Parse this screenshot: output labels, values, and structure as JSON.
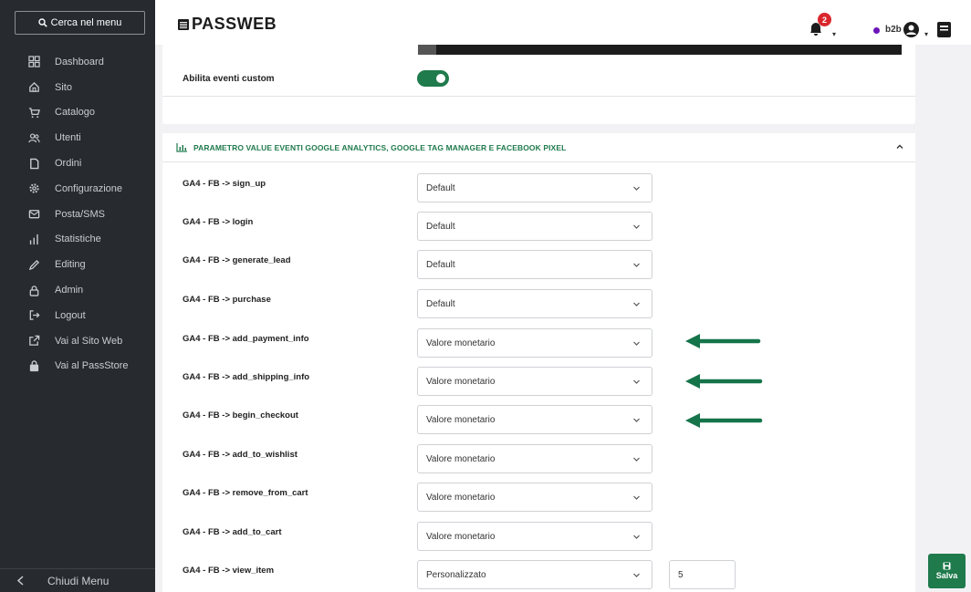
{
  "sidebar": {
    "search_label": "Cerca nel menu",
    "items": [
      {
        "label": "Dashboard",
        "icon": "dashboard-icon"
      },
      {
        "label": "Sito",
        "icon": "home-icon"
      },
      {
        "label": "Catalogo",
        "icon": "cart-icon"
      },
      {
        "label": "Utenti",
        "icon": "users-icon"
      },
      {
        "label": "Ordini",
        "icon": "document-icon"
      },
      {
        "label": "Configurazione",
        "icon": "gear-icon"
      },
      {
        "label": "Posta/SMS",
        "icon": "mail-icon"
      },
      {
        "label": "Statistiche",
        "icon": "bar-chart-icon"
      },
      {
        "label": "Editing",
        "icon": "pencil-icon"
      },
      {
        "label": "Admin",
        "icon": "lock-icon"
      },
      {
        "label": "Logout",
        "icon": "logout-icon"
      },
      {
        "label": "Vai al Sito Web",
        "icon": "external-link-icon"
      },
      {
        "label": "Vai al PassStore",
        "icon": "bag-icon"
      }
    ],
    "footer_label": "Chiudi Menu"
  },
  "header": {
    "logo": "PASSWEB",
    "notifications_count": "2",
    "user_code": "b2b",
    "status_color": "#6b14b8"
  },
  "top_section": {
    "label": "Abilita eventi custom",
    "toggle_on": true
  },
  "section": {
    "title": "PARAMETRO VALUE EVENTI GOOGLE ANALYTICS, GOOGLE TAG MANAGER E FACEBOOK PIXEL",
    "rows": [
      {
        "label": "GA4 - FB -> sign_up",
        "value": "Default"
      },
      {
        "label": "GA4 - FB -> login",
        "value": "Default"
      },
      {
        "label": "GA4 - FB -> generate_lead",
        "value": "Default"
      },
      {
        "label": "GA4 - FB -> purchase",
        "value": "Default"
      },
      {
        "label": "GA4 - FB -> add_payment_info",
        "value": "Valore monetario",
        "highlight": true
      },
      {
        "label": "GA4 - FB -> add_shipping_info",
        "value": "Valore monetario",
        "highlight": true
      },
      {
        "label": "GA4 - FB -> begin_checkout",
        "value": "Valore monetario",
        "highlight": true
      },
      {
        "label": "GA4 - FB -> add_to_wishlist",
        "value": "Valore monetario"
      },
      {
        "label": "GA4 - FB -> remove_from_cart",
        "value": "Valore monetario"
      },
      {
        "label": "GA4 - FB -> add_to_cart",
        "value": "Valore monetario"
      },
      {
        "label": "GA4 - FB -> view_item",
        "value": "Personalizzato",
        "custom_value": "5"
      }
    ]
  },
  "save_label": "Salva",
  "colors": {
    "accent": "#1f7a4c",
    "sidebar_bg": "#272b30",
    "badge": "#d9262d"
  }
}
